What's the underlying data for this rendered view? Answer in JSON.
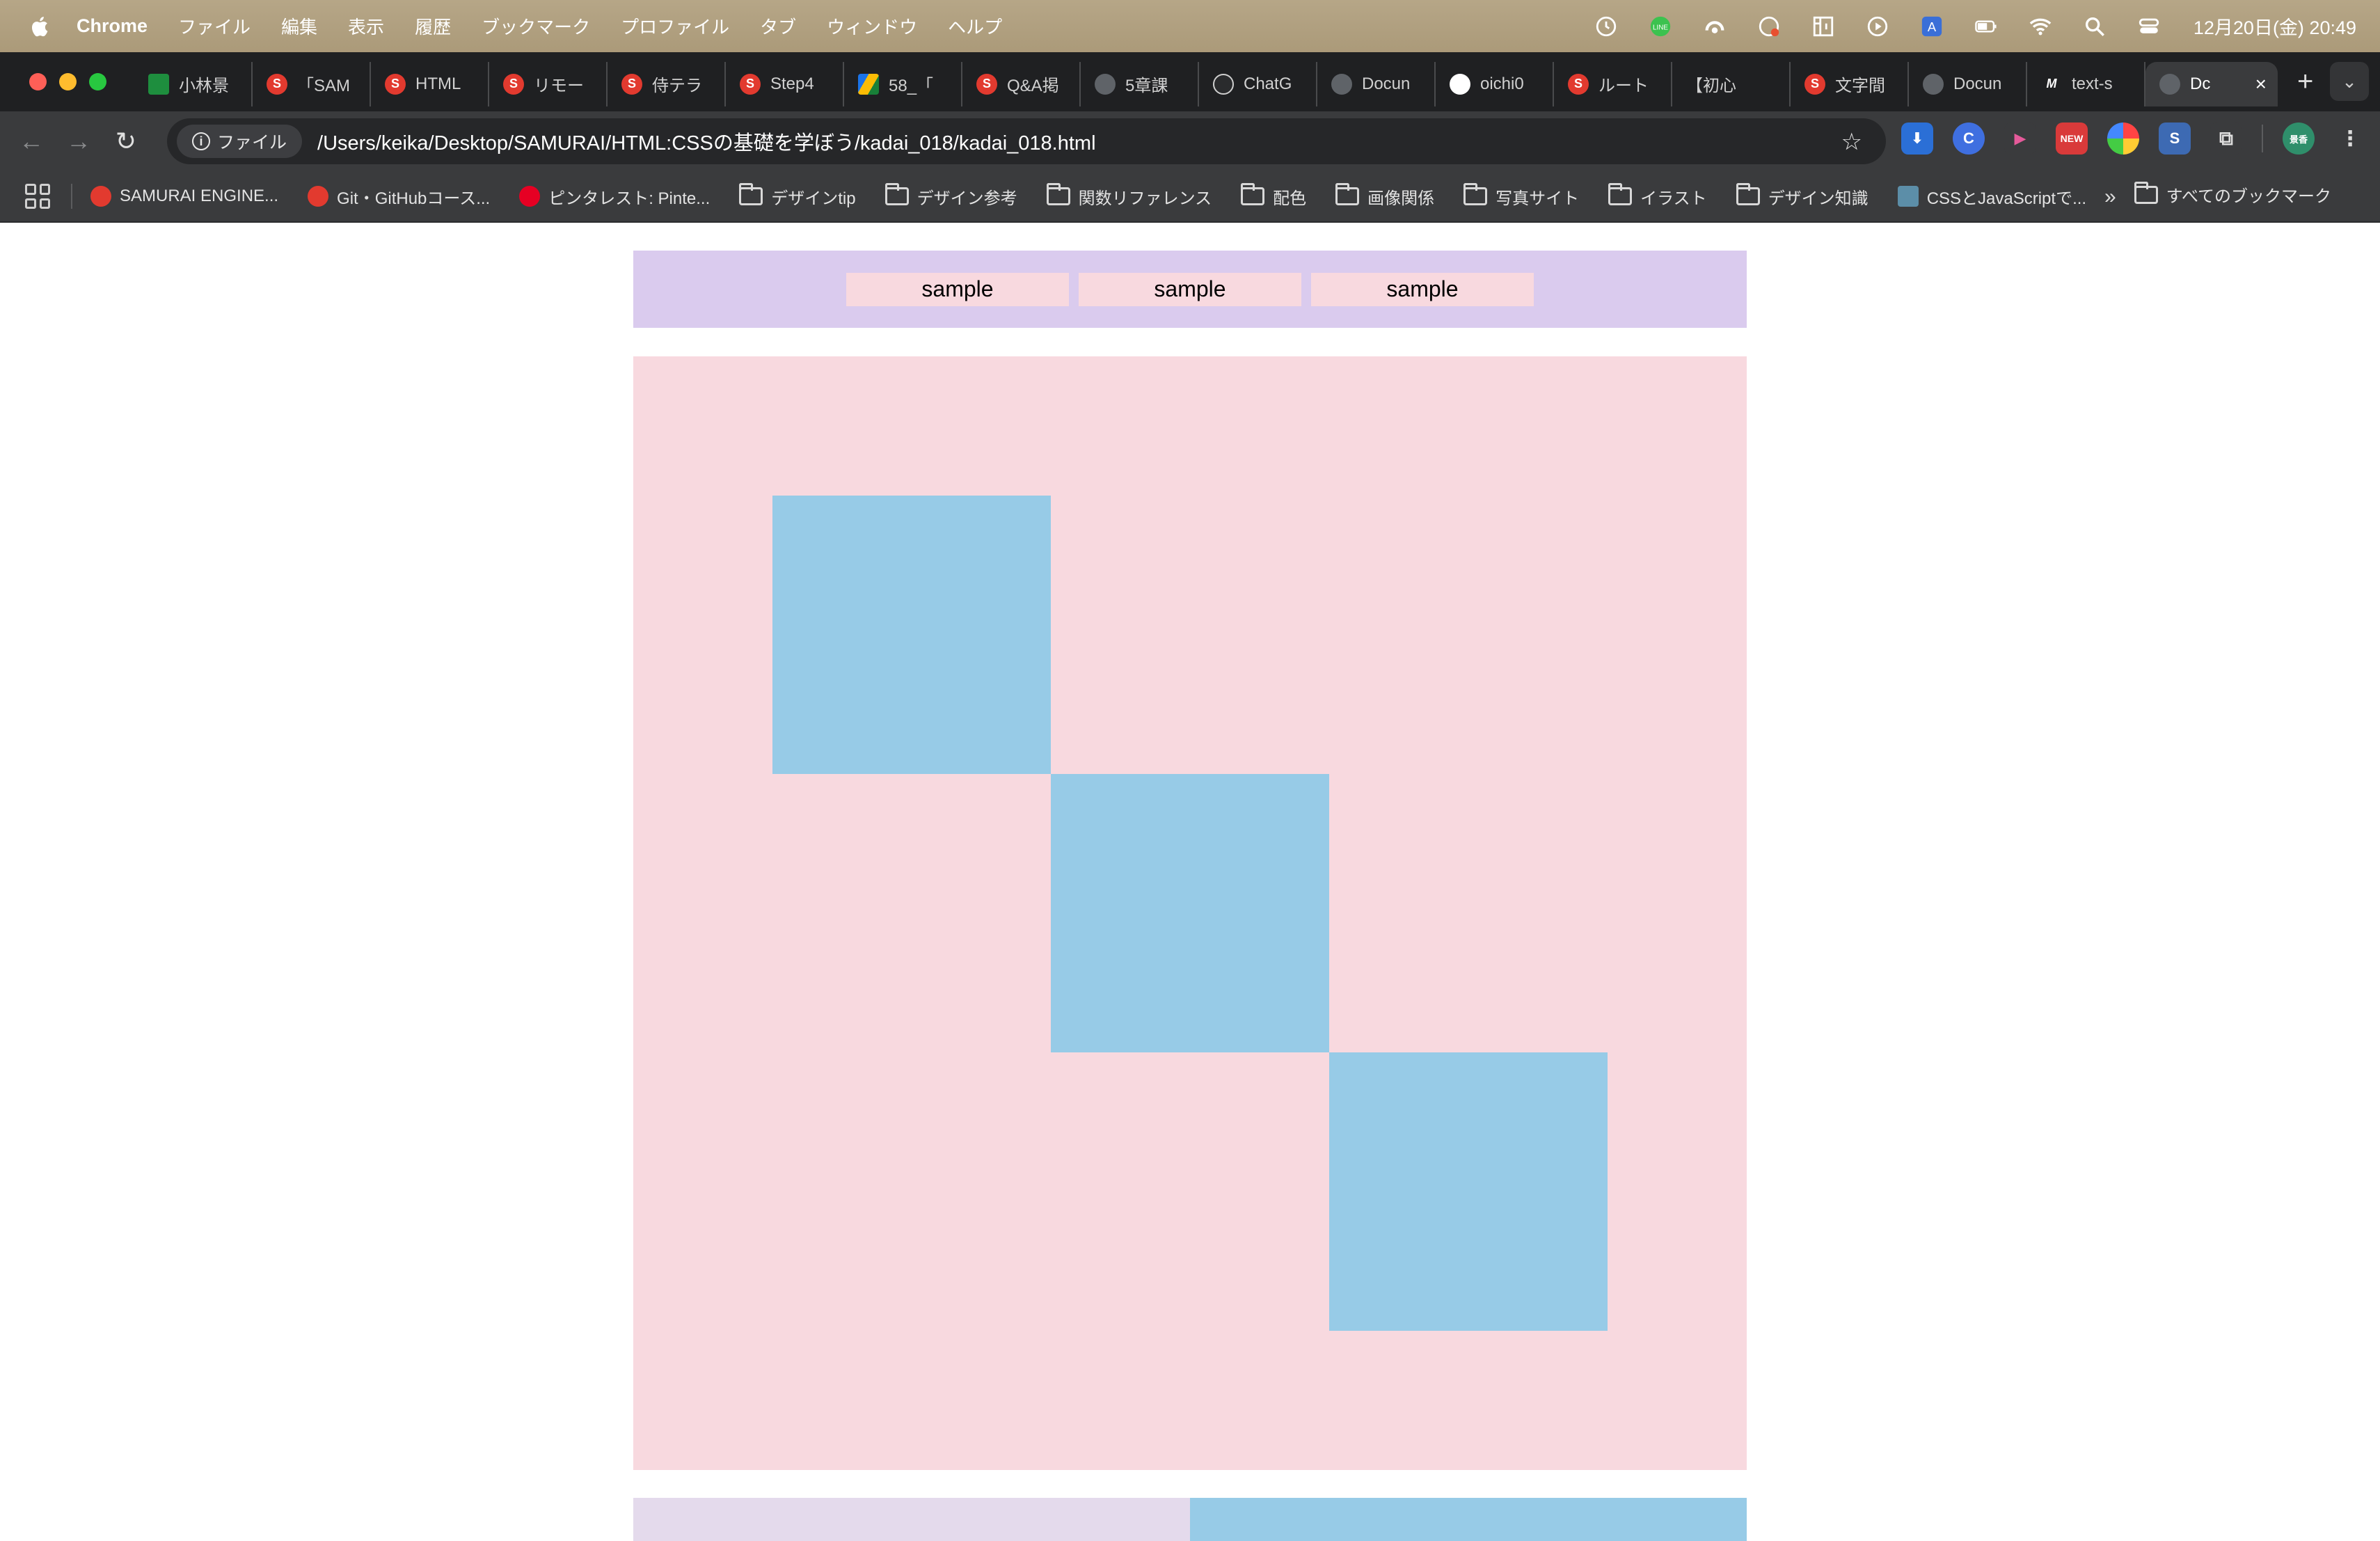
{
  "menubar": {
    "app_name": "Chrome",
    "items": [
      "ファイル",
      "編集",
      "表示",
      "履歴",
      "ブックマーク",
      "プロファイル",
      "タブ",
      "ウィンドウ",
      "ヘルプ"
    ],
    "clock": "12月20日(金) 20:49",
    "status_icons": [
      "time-machine-icon",
      "line-icon",
      "cloud-sync-icon",
      "hazard-icon",
      "grid-icon",
      "play-icon",
      "input-method-icon",
      "battery-icon",
      "wifi-icon",
      "spotlight-icon",
      "control-center-icon"
    ],
    "input_method_label": "A"
  },
  "tabs": [
    {
      "label": "小林景",
      "icon": "sheets-icon"
    },
    {
      "label": "「SAM",
      "icon": "samurai-icon"
    },
    {
      "label": "HTML",
      "icon": "samurai-icon"
    },
    {
      "label": "リモー",
      "icon": "samurai-icon"
    },
    {
      "label": "侍テラ",
      "icon": "samurai-icon"
    },
    {
      "label": "Step4",
      "icon": "samurai-icon"
    },
    {
      "label": "58_「",
      "icon": "drive-icon"
    },
    {
      "label": "Q&A掲",
      "icon": "samurai-icon"
    },
    {
      "label": "5章課",
      "icon": "globe-icon"
    },
    {
      "label": "ChatG",
      "icon": "chatgpt-icon"
    },
    {
      "label": "Docun",
      "icon": "globe-icon"
    },
    {
      "label": "oichi0",
      "icon": "github-icon"
    },
    {
      "label": "ルート",
      "icon": "samurai-icon"
    },
    {
      "label": "【初心",
      "icon": "none"
    },
    {
      "label": "文字間",
      "icon": "samurai-icon"
    },
    {
      "label": "Docun",
      "icon": "globe-icon"
    },
    {
      "label": "text-s",
      "icon": "m-icon"
    },
    {
      "label": "Dc",
      "icon": "globe-icon",
      "active": true
    }
  ],
  "toolbar": {
    "chip_label": "ファイル",
    "url": "/Users/keika/Desktop/SAMURAI/HTML:CSSの基礎を学ぼう/kadai_018/kadai_018.html",
    "extensions": [
      "download-ext-icon",
      "c-ext-icon",
      "video-ext-icon",
      "gift-ext-icon",
      "color-ext-icon",
      "s-ext-icon",
      "puzzle-ext-icon",
      "profile-avatar"
    ],
    "new_badge": "NEW",
    "avatar_text": "景香"
  },
  "bookmarks": {
    "items": [
      {
        "label": "SAMURAI ENGINE...",
        "icon": "samurai-icon"
      },
      {
        "label": "Git・GitHubコース...",
        "icon": "samurai-icon"
      },
      {
        "label": "ピンタレスト: Pinte...",
        "icon": "pinterest-icon"
      },
      {
        "label": "デザインtip",
        "icon": "folder-icon"
      },
      {
        "label": "デザイン参考",
        "icon": "folder-icon"
      },
      {
        "label": "関数リファレンス",
        "icon": "folder-icon"
      },
      {
        "label": "配色",
        "icon": "folder-icon"
      },
      {
        "label": "画像関係",
        "icon": "folder-icon"
      },
      {
        "label": "写真サイト",
        "icon": "folder-icon"
      },
      {
        "label": "イラスト",
        "icon": "folder-icon"
      },
      {
        "label": "デザイン知識",
        "icon": "folder-icon"
      },
      {
        "label": "CSSとJavaScriptで...",
        "icon": "page-icon"
      }
    ],
    "all_label": "すべてのブックマーク"
  },
  "page": {
    "nav_items": [
      "sample",
      "sample",
      "sample"
    ],
    "colors": {
      "nav_bg": "#dacbee",
      "pink": "#f8d9df",
      "blue": "#97cbe7",
      "lavender": "#e4daec"
    }
  }
}
